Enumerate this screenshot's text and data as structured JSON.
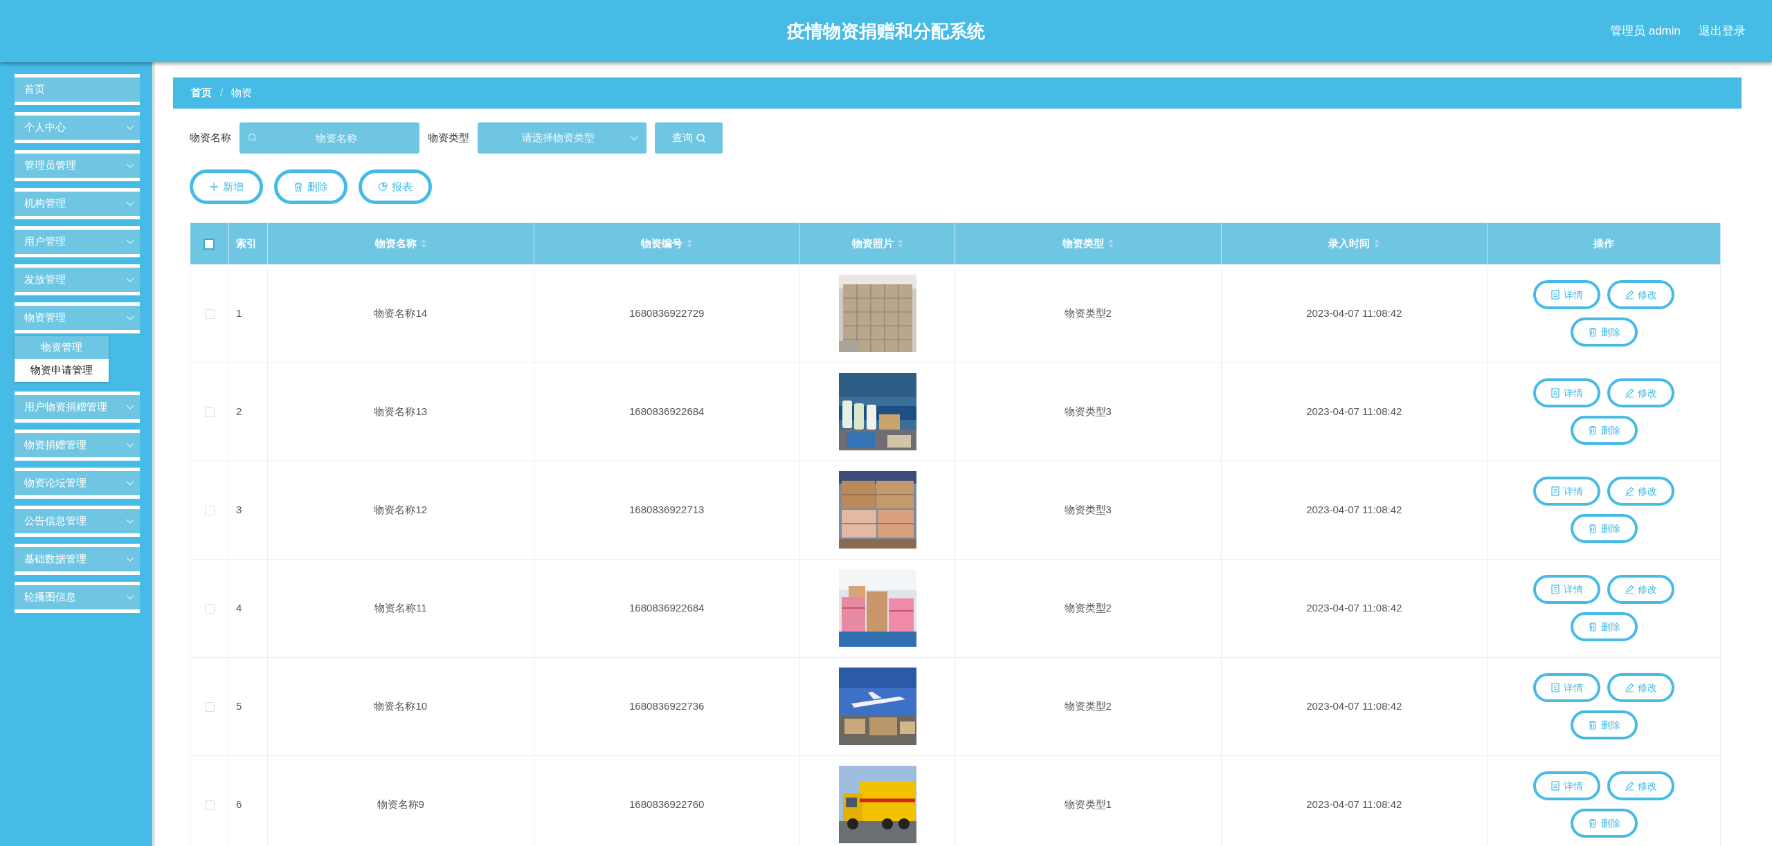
{
  "header": {
    "title": "疫情物资捐赠和分配系统",
    "user": "管理员 admin",
    "logout": "退出登录"
  },
  "sidebar": {
    "items": [
      {
        "kind": "link",
        "label": "首页"
      },
      {
        "kind": "group",
        "label": "个人中心"
      },
      {
        "kind": "group",
        "label": "管理员管理"
      },
      {
        "kind": "group",
        "label": "机构管理"
      },
      {
        "kind": "group",
        "label": "用户管理"
      },
      {
        "kind": "group",
        "label": "发放管理"
      },
      {
        "kind": "group",
        "label": "物资管理",
        "children": [
          {
            "label": "物资管理",
            "selected": true
          },
          {
            "label": "物资申请管理",
            "selected": false
          }
        ]
      },
      {
        "kind": "group",
        "label": "用户物资捐赠管理"
      },
      {
        "kind": "group",
        "label": "物资捐赠管理"
      },
      {
        "kind": "group",
        "label": "物资论坛管理"
      },
      {
        "kind": "group",
        "label": "公告信息管理"
      },
      {
        "kind": "group",
        "label": "基础数据管理"
      },
      {
        "kind": "group",
        "label": "轮播图信息"
      }
    ]
  },
  "breadcrumb": {
    "items": [
      "首页",
      "物资"
    ],
    "separator": "/"
  },
  "search": {
    "name_label": "物资名称",
    "name_placeholder": "物资名称",
    "type_label": "物资类型",
    "type_placeholder": "请选择物资类型",
    "button": "查询"
  },
  "toolbar": [
    {
      "kind": "add",
      "label": "新增"
    },
    {
      "kind": "delete",
      "label": "删除"
    },
    {
      "kind": "report",
      "label": "报表"
    }
  ],
  "table": {
    "select_all_checked": false,
    "columns": [
      {
        "kind": "plain",
        "label": "索引"
      },
      {
        "kind": "sortable",
        "label": "物资名称"
      },
      {
        "kind": "sortable",
        "label": "物资编号"
      },
      {
        "kind": "sortable",
        "label": "物资照片"
      },
      {
        "kind": "sortable",
        "label": "物资类型"
      },
      {
        "kind": "sortable",
        "label": "录入时间"
      },
      {
        "kind": "plain",
        "label": "操作"
      }
    ],
    "rows": [
      {
        "checked": false,
        "index": "1",
        "name": "物资名称14",
        "code": "1680836922729",
        "type": "物资类型2",
        "time": "2023-04-07 11:08:42",
        "actions": [
          {
            "kind": "detail",
            "label": "详情"
          },
          {
            "kind": "edit",
            "label": "修改"
          },
          {
            "kind": "delete",
            "label": "删除"
          }
        ]
      },
      {
        "checked": false,
        "index": "2",
        "name": "物资名称13",
        "code": "1680836922684",
        "type": "物资类型3",
        "time": "2023-04-07 11:08:42",
        "actions": [
          {
            "kind": "detail",
            "label": "详情"
          },
          {
            "kind": "edit",
            "label": "修改"
          },
          {
            "kind": "delete",
            "label": "删除"
          }
        ]
      },
      {
        "checked": false,
        "index": "3",
        "name": "物资名称12",
        "code": "1680836922713",
        "type": "物资类型3",
        "time": "2023-04-07 11:08:42",
        "actions": [
          {
            "kind": "detail",
            "label": "详情"
          },
          {
            "kind": "edit",
            "label": "修改"
          },
          {
            "kind": "delete",
            "label": "删除"
          }
        ]
      },
      {
        "checked": false,
        "index": "4",
        "name": "物资名称11",
        "code": "1680836922684",
        "type": "物资类型2",
        "time": "2023-04-07 11:08:42",
        "actions": [
          {
            "kind": "detail",
            "label": "详情"
          },
          {
            "kind": "edit",
            "label": "修改"
          },
          {
            "kind": "delete",
            "label": "删除"
          }
        ]
      },
      {
        "checked": false,
        "index": "5",
        "name": "物资名称10",
        "code": "1680836922736",
        "type": "物资类型2",
        "time": "2023-04-07 11:08:42",
        "actions": [
          {
            "kind": "detail",
            "label": "详情"
          },
          {
            "kind": "edit",
            "label": "修改"
          },
          {
            "kind": "delete",
            "label": "删除"
          }
        ]
      },
      {
        "checked": false,
        "index": "6",
        "name": "物资名称9",
        "code": "1680836922760",
        "type": "物资类型1",
        "time": "2023-04-07 11:08:42",
        "actions": [
          {
            "kind": "detail",
            "label": "详情"
          },
          {
            "kind": "edit",
            "label": "修改"
          },
          {
            "kind": "delete",
            "label": "删除"
          }
        ]
      }
    ]
  }
}
